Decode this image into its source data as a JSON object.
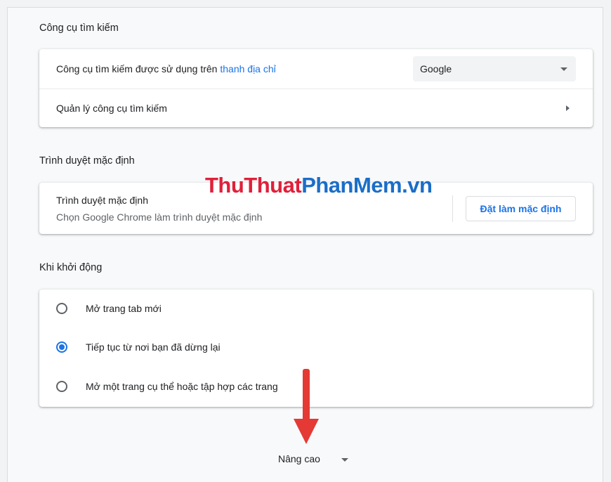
{
  "search_engine": {
    "section_title": "Công cụ tìm kiếm",
    "used_in_prefix": "Công cụ tìm kiếm được sử dụng trên ",
    "used_in_link": "thanh địa chỉ",
    "selected_engine": "Google",
    "manage_label": "Quản lý công cụ tìm kiếm"
  },
  "default_browser": {
    "section_title": "Trình duyệt mặc định",
    "row_title": "Trình duyệt mặc định",
    "row_subtitle": "Chọn Google Chrome làm trình duyệt mặc định",
    "button_label": "Đặt làm mặc định"
  },
  "watermark": {
    "part1": "ThuThuat",
    "part2": "PhanMem",
    "part3": ".vn"
  },
  "startup": {
    "section_title": "Khi khởi động",
    "options": [
      {
        "label": "Mở trang tab mới",
        "checked": false
      },
      {
        "label": "Tiếp tục từ nơi bạn đã dừng lại",
        "checked": true
      },
      {
        "label": "Mở một trang cụ thể hoặc tập hợp các trang",
        "checked": false
      }
    ]
  },
  "advanced": {
    "label": "Nâng cao"
  },
  "colors": {
    "accent": "#1a73e8",
    "annotation_arrow": "#e53935",
    "watermark_red": "#e0203a",
    "watermark_blue": "#1a6ec8"
  }
}
